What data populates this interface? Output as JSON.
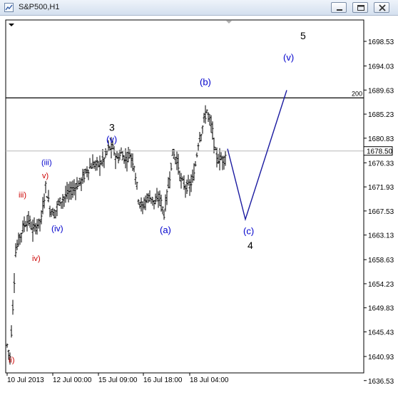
{
  "window": {
    "title": "S&P500,H1",
    "minimize_icon": "minimize-icon",
    "maximize_icon": "restore-icon",
    "close_icon": "close-icon"
  },
  "chart_data": {
    "type": "candlestick",
    "symbol": "S&P500",
    "timeframe": "H1",
    "y_ticks": [
      "1698.53",
      "1694.03",
      "1689.63",
      "1685.23",
      "1680.83",
      "1676.33",
      "1671.93",
      "1667.53",
      "1663.13",
      "1658.63",
      "1654.23",
      "1649.83",
      "1645.43",
      "1640.93",
      "1636.53"
    ],
    "x_ticks": [
      "10 Jul 2013",
      "12 Jul 00:00",
      "15 Jul 09:00",
      "16 Jul 18:00",
      "18 Jul 04:00"
    ],
    "ylim": [
      1636.53,
      1698.53
    ],
    "current_price": "1678.50",
    "horizontal_line": {
      "label": "200",
      "value": 1688.2
    },
    "bid_line_value": 1678.5,
    "projection_path": [
      [
        1678.9,
        "start"
      ],
      [
        1666.0,
        "(c)"
      ],
      [
        1689.6,
        "(v)"
      ]
    ],
    "wave_labels": [
      {
        "text": "ii)",
        "color": "#cc0000",
        "price": 1639.8
      },
      {
        "text": "iii)",
        "color": "#cc0000",
        "price": 1670.0
      },
      {
        "text": "iv)",
        "color": "#cc0000",
        "price": 1658.4
      },
      {
        "text": "v)",
        "color": "#cc0000",
        "price": 1673.5
      },
      {
        "text": "(iii)",
        "color": "#0000cc",
        "price": 1675.9
      },
      {
        "text": "(iv)",
        "color": "#0000cc",
        "price": 1663.8
      },
      {
        "text": "3",
        "color": "#000000",
        "price": 1682.2
      },
      {
        "text": "(v)",
        "color": "#0000cc",
        "price": 1680.0
      },
      {
        "text": "(a)",
        "color": "#0000cc",
        "price": 1663.5
      },
      {
        "text": "(b)",
        "color": "#0000cc",
        "price": 1690.5
      },
      {
        "text": "(c)",
        "color": "#0000cc",
        "price": 1663.3
      },
      {
        "text": "4",
        "color": "#000000",
        "price": 1660.6
      },
      {
        "text": "(v)",
        "color": "#0000cc",
        "price": 1695.0
      },
      {
        "text": "5",
        "color": "#000000",
        "price": 1698.9
      }
    ]
  }
}
